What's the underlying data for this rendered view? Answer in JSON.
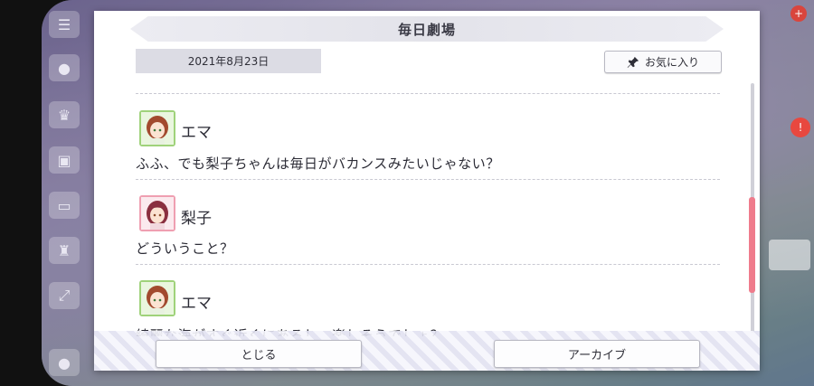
{
  "dialog": {
    "title": "毎日劇場",
    "date": "2021年8月23日",
    "favorite_label": "お気に入り",
    "close_label": "とじる",
    "archive_label": "アーカイブ"
  },
  "messages": [
    {
      "speaker": "エマ",
      "text": "ふふ、でも梨子ちゃんは毎日がバカンスみたいじゃない？"
    },
    {
      "speaker": "梨子",
      "text": "どういうこと？"
    },
    {
      "speaker": "エマ",
      "text": "綺麗な海がすぐ近くにあるし、楽しそうでしょ？"
    }
  ],
  "colors": {
    "accent_scroll": "#ef7c8c",
    "emma_frame": "#9fd27a",
    "riko_frame": "#ef9fb1"
  },
  "icons": {
    "favorite": "pin-icon"
  }
}
